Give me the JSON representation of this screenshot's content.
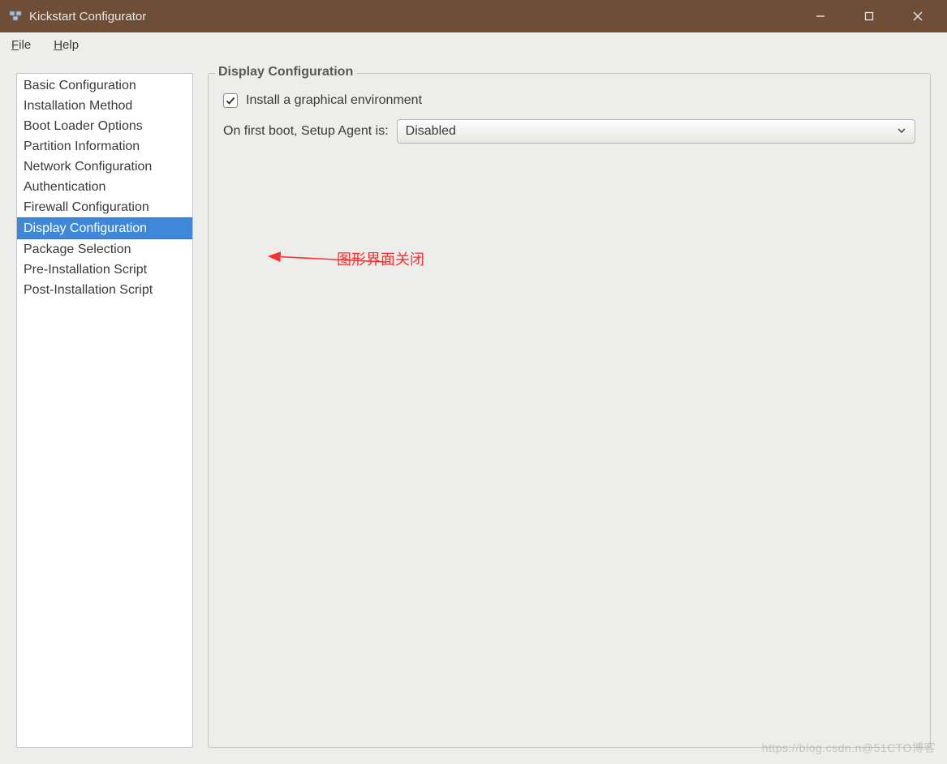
{
  "titlebar": {
    "title": "Kickstart Configurator"
  },
  "menubar": {
    "file": {
      "label": "File",
      "mnemonic": "F"
    },
    "help": {
      "label": "Help",
      "mnemonic": "H"
    }
  },
  "sidebar": {
    "items": [
      {
        "label": "Basic Configuration"
      },
      {
        "label": "Installation Method"
      },
      {
        "label": "Boot Loader Options"
      },
      {
        "label": "Partition Information"
      },
      {
        "label": "Network Configuration"
      },
      {
        "label": "Authentication"
      },
      {
        "label": "Firewall Configuration"
      },
      {
        "label": "Display Configuration",
        "selected": true
      },
      {
        "label": "Package Selection"
      },
      {
        "label": "Pre-Installation Script"
      },
      {
        "label": "Post-Installation Script"
      }
    ]
  },
  "panel": {
    "group_title": "Display Configuration",
    "install_graphical": {
      "label": "Install a graphical environment",
      "checked": true
    },
    "setup_agent": {
      "label": "On first boot, Setup Agent is:",
      "value": "Disabled"
    }
  },
  "annotation": {
    "text": "图形界面关闭"
  },
  "watermark": {
    "text": "https://blog.csdn.n@51CTO博客"
  }
}
